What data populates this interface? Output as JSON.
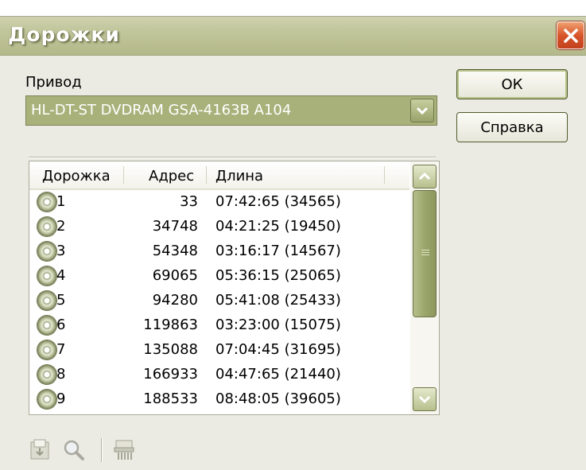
{
  "window": {
    "title": "Дорожки"
  },
  "drive": {
    "label": "Привод",
    "selected": "HL-DT-ST DVDRAM GSA-4163B A104"
  },
  "buttons": {
    "ok": "ОК",
    "help": "Справка"
  },
  "columns": {
    "track": "Дорожка",
    "address": "Адрес",
    "length": "Длина"
  },
  "tracks": [
    {
      "track": "1",
      "address": "33",
      "length": "07:42:65 (34565)"
    },
    {
      "track": "2",
      "address": "34748",
      "length": "04:21:25 (19450)"
    },
    {
      "track": "3",
      "address": "54348",
      "length": "03:16:17 (14567)"
    },
    {
      "track": "4",
      "address": "69065",
      "length": "05:36:15 (25065)"
    },
    {
      "track": "5",
      "address": "94280",
      "length": "05:41:08 (25433)"
    },
    {
      "track": "6",
      "address": "119863",
      "length": "03:23:00 (15075)"
    },
    {
      "track": "7",
      "address": "135088",
      "length": "07:04:45 (31695)"
    },
    {
      "track": "8",
      "address": "166933",
      "length": "04:47:65 (21440)"
    },
    {
      "track": "9",
      "address": "188533",
      "length": "08:48:05 (39605)"
    }
  ],
  "toolbar": [
    "save-tracks-icon",
    "search-icon",
    "shred-icon"
  ]
}
